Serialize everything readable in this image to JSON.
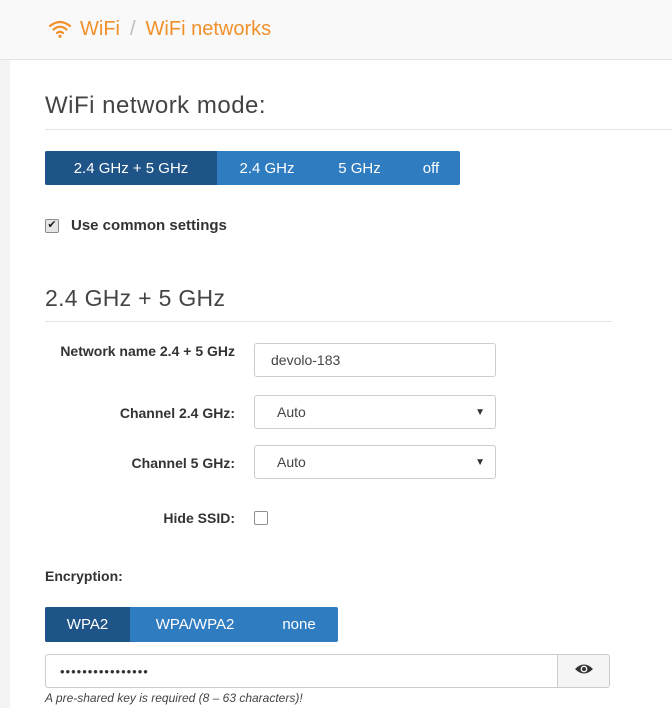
{
  "breadcrumb": {
    "icon": "wifi-icon",
    "section": "WiFi",
    "separator": "/",
    "page": "WiFi networks",
    "color": "#f0902a"
  },
  "mode": {
    "heading": "WiFi network mode:",
    "options": [
      "2.4 GHz + 5 GHz",
      "2.4 GHz",
      "5 GHz",
      "off"
    ],
    "selected": "2.4 GHz + 5 GHz",
    "accent": "#2f7cc0",
    "active_color": "#1e5487"
  },
  "common_settings": {
    "label": "Use common settings",
    "checked": true
  },
  "band": {
    "heading": "2.4 GHz + 5 GHz",
    "network_name_label": "Network name 2.4 + 5 GHz",
    "network_name_value": "devolo-183",
    "channel_24_label": "Channel 2.4 GHz:",
    "channel_24_value": "Auto",
    "channel_5_label": "Channel 5 GHz:",
    "channel_5_value": "Auto",
    "hide_ssid_label": "Hide SSID:",
    "hide_ssid_checked": false
  },
  "encryption": {
    "label": "Encryption:",
    "options": [
      "WPA2",
      "WPA/WPA2",
      "none"
    ],
    "selected": "WPA2",
    "password_mask": "••••••••••••••••",
    "reveal_icon": "eye-icon",
    "help_text": "A pre-shared key is required (8 – 63 characters)!"
  }
}
